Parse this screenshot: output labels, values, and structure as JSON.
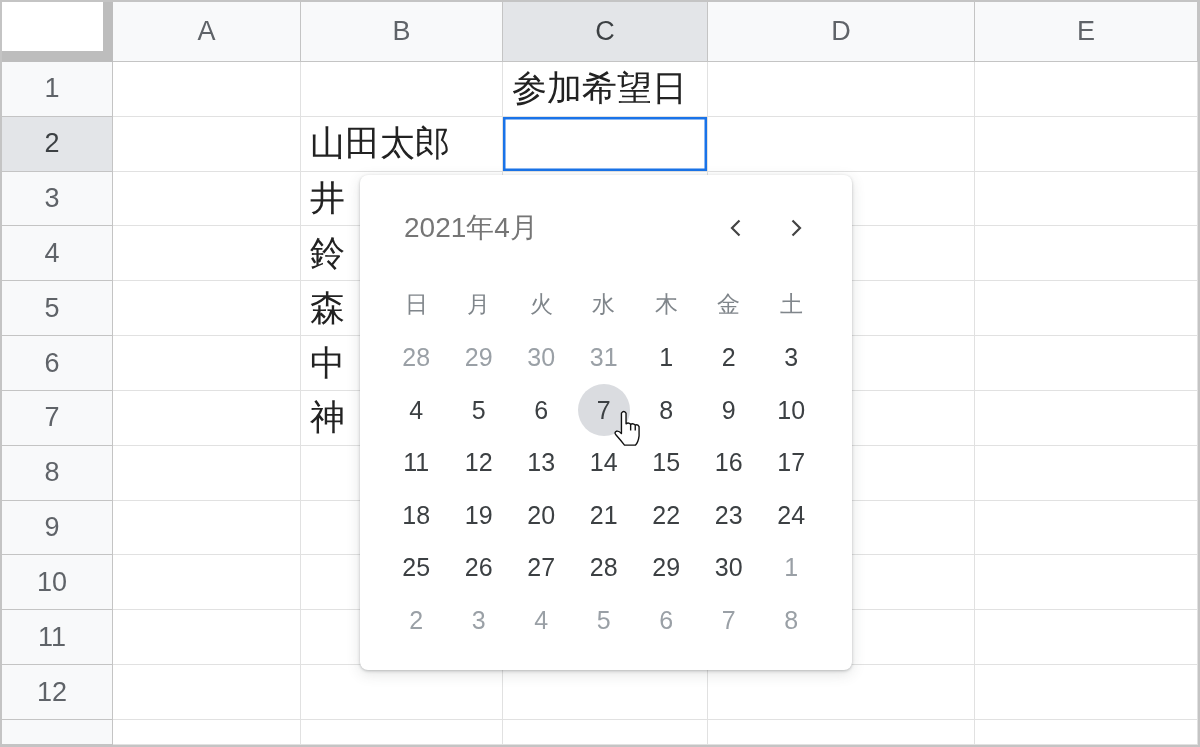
{
  "sheet": {
    "columns": [
      {
        "label": "A",
        "highlighted": false
      },
      {
        "label": "B",
        "highlighted": false
      },
      {
        "label": "C",
        "highlighted": true
      },
      {
        "label": "D",
        "highlighted": false
      },
      {
        "label": "E",
        "highlighted": false
      }
    ],
    "rows": [
      {
        "label": "1",
        "highlighted": false,
        "cells": [
          {
            "selected": false
          },
          {
            "selected": false
          },
          {
            "text": "参加希望日",
            "selected": false
          },
          {
            "selected": false
          },
          {
            "selected": false
          }
        ]
      },
      {
        "label": "2",
        "highlighted": true,
        "cells": [
          {
            "selected": false
          },
          {
            "text": "山田太郎",
            "selected": false
          },
          {
            "selected": true
          },
          {
            "selected": false
          },
          {
            "selected": false
          }
        ]
      },
      {
        "label": "3",
        "highlighted": false,
        "cells": [
          {
            "selected": false
          },
          {
            "text": "井",
            "selected": false
          },
          {
            "selected": false
          },
          {
            "selected": false
          },
          {
            "selected": false
          }
        ]
      },
      {
        "label": "4",
        "highlighted": false,
        "cells": [
          {
            "selected": false
          },
          {
            "text": "鈴",
            "selected": false
          },
          {},
          {
            "selected": false
          },
          {
            "selected": false
          }
        ]
      },
      {
        "label": "5",
        "highlighted": false,
        "cells": [
          {
            "selected": false
          },
          {
            "text": "森",
            "selected": false
          },
          {},
          {
            "selected": false
          },
          {
            "selected": false
          }
        ]
      },
      {
        "label": "6",
        "highlighted": false,
        "cells": [
          {
            "selected": false
          },
          {
            "text": "中",
            "selected": false
          },
          {},
          {
            "selected": false
          },
          {
            "selected": false
          }
        ]
      },
      {
        "label": "7",
        "highlighted": false,
        "cells": [
          {
            "selected": false
          },
          {
            "text": "神",
            "selected": false
          },
          {},
          {
            "selected": false
          },
          {
            "selected": false
          }
        ]
      },
      {
        "label": "8",
        "highlighted": false,
        "cells": [
          {
            "selected": false
          },
          {
            "selected": false
          },
          {},
          {
            "selected": false
          },
          {
            "selected": false
          }
        ]
      },
      {
        "label": "9",
        "highlighted": false,
        "cells": [
          {
            "selected": false
          },
          {
            "selected": false
          },
          {},
          {
            "selected": false
          },
          {
            "selected": false
          }
        ]
      },
      {
        "label": "10",
        "highlighted": false,
        "cells": [
          {
            "selected": false
          },
          {
            "selected": false
          },
          {},
          {
            "selected": false
          },
          {
            "selected": false
          }
        ]
      },
      {
        "label": "11",
        "highlighted": false,
        "cells": [
          {
            "selected": false
          },
          {
            "selected": false
          },
          {},
          {
            "selected": false
          },
          {
            "selected": false
          }
        ]
      },
      {
        "label": "12",
        "highlighted": false,
        "cells": [
          {
            "selected": false
          },
          {
            "selected": false
          },
          {
            "selected": false
          },
          {
            "selected": false
          },
          {
            "selected": false
          }
        ]
      }
    ]
  },
  "date_picker": {
    "title": "2021年4月",
    "weekdays": [
      "日",
      "月",
      "火",
      "水",
      "木",
      "金",
      "土"
    ],
    "weeks": [
      [
        {
          "label": "28",
          "other_month": true,
          "hovered": false
        },
        {
          "label": "29",
          "other_month": true,
          "hovered": false
        },
        {
          "label": "30",
          "other_month": true,
          "hovered": false
        },
        {
          "label": "31",
          "other_month": true,
          "hovered": false
        },
        {
          "label": "1",
          "other_month": false,
          "hovered": false
        },
        {
          "label": "2",
          "other_month": false,
          "hovered": false
        },
        {
          "label": "3",
          "other_month": false,
          "hovered": false
        }
      ],
      [
        {
          "label": "4",
          "other_month": false,
          "hovered": false
        },
        {
          "label": "5",
          "other_month": false,
          "hovered": false
        },
        {
          "label": "6",
          "other_month": false,
          "hovered": false
        },
        {
          "label": "7",
          "other_month": false,
          "hovered": true
        },
        {
          "label": "8",
          "other_month": false,
          "hovered": false
        },
        {
          "label": "9",
          "other_month": false,
          "hovered": false
        },
        {
          "label": "10",
          "other_month": false,
          "hovered": false
        }
      ],
      [
        {
          "label": "11",
          "other_month": false,
          "hovered": false
        },
        {
          "label": "12",
          "other_month": false,
          "hovered": false
        },
        {
          "label": "13",
          "other_month": false,
          "hovered": false
        },
        {
          "label": "14",
          "other_month": false,
          "hovered": false
        },
        {
          "label": "15",
          "other_month": false,
          "hovered": false
        },
        {
          "label": "16",
          "other_month": false,
          "hovered": false
        },
        {
          "label": "17",
          "other_month": false,
          "hovered": false
        }
      ],
      [
        {
          "label": "18",
          "other_month": false,
          "hovered": false
        },
        {
          "label": "19",
          "other_month": false,
          "hovered": false
        },
        {
          "label": "20",
          "other_month": false,
          "hovered": false
        },
        {
          "label": "21",
          "other_month": false,
          "hovered": false
        },
        {
          "label": "22",
          "other_month": false,
          "hovered": false
        },
        {
          "label": "23",
          "other_month": false,
          "hovered": false
        },
        {
          "label": "24",
          "other_month": false,
          "hovered": false
        }
      ],
      [
        {
          "label": "25",
          "other_month": false,
          "hovered": false
        },
        {
          "label": "26",
          "other_month": false,
          "hovered": false
        },
        {
          "label": "27",
          "other_month": false,
          "hovered": false
        },
        {
          "label": "28",
          "other_month": false,
          "hovered": false
        },
        {
          "label": "29",
          "other_month": false,
          "hovered": false
        },
        {
          "label": "30",
          "other_month": false,
          "hovered": false
        },
        {
          "label": "1",
          "other_month": true,
          "hovered": false
        }
      ],
      [
        {
          "label": "2",
          "other_month": true,
          "hovered": false
        },
        {
          "label": "3",
          "other_month": true,
          "hovered": false
        },
        {
          "label": "4",
          "other_month": true,
          "hovered": false
        },
        {
          "label": "5",
          "other_month": true,
          "hovered": false
        },
        {
          "label": "6",
          "other_month": true,
          "hovered": false
        },
        {
          "label": "7",
          "other_month": true,
          "hovered": false
        },
        {
          "label": "8",
          "other_month": true,
          "hovered": false
        }
      ]
    ]
  }
}
